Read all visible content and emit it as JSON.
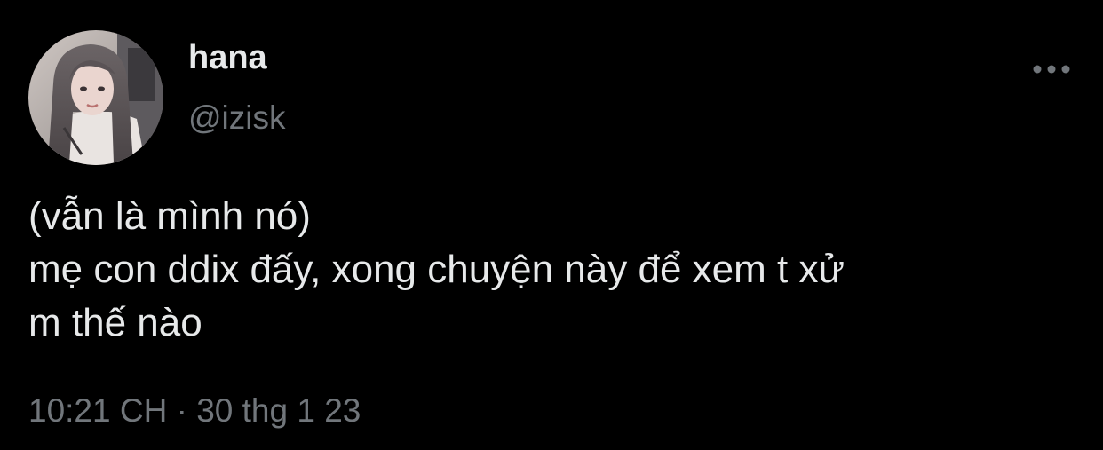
{
  "tweet": {
    "author": {
      "display_name": "hana",
      "handle": "@izisk",
      "avatar_icon": "profile-photo"
    },
    "more_icon": "more-horizontal-icon",
    "body_lines": [
      "(vẫn là mình nó)",
      "mẹ con ddix đấy, xong chuyện này để xem t xử",
      "m thế nào"
    ],
    "timestamp": {
      "time": "10:21 CH",
      "separator": "·",
      "date": "30 thg 1 23"
    }
  },
  "colors": {
    "background": "#000000",
    "primary_text": "#e7e9ea",
    "secondary_text": "#71767b"
  }
}
